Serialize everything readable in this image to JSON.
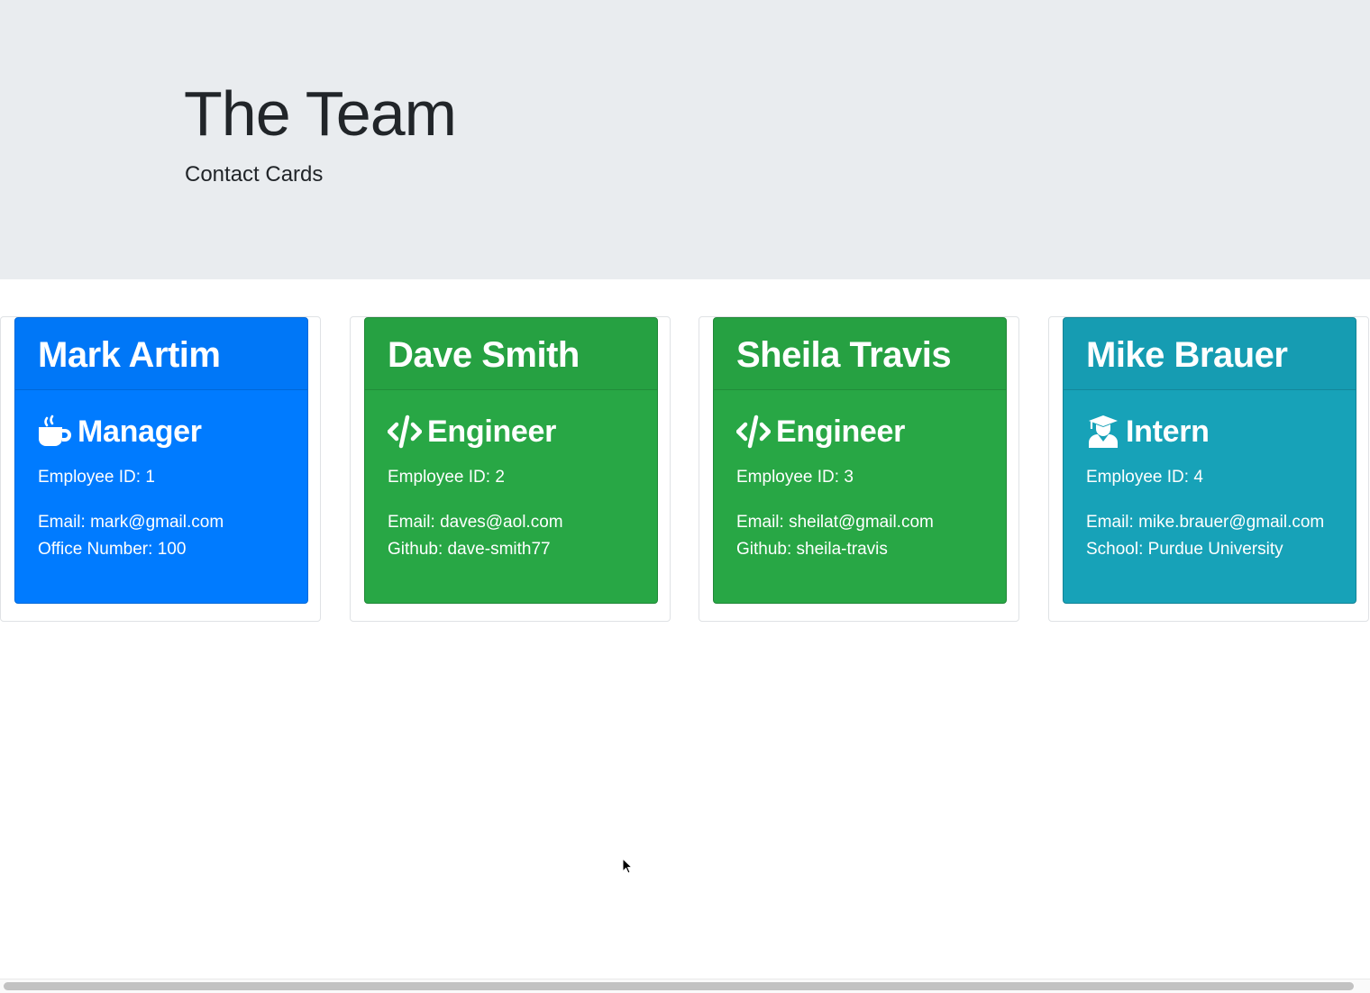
{
  "header": {
    "title": "The Team",
    "subtitle": "Contact Cards"
  },
  "cards": [
    {
      "name": "Mark Artim",
      "role": "Manager",
      "role_icon": "coffee-mug-icon",
      "color": "#007bff",
      "id_line": "Employee ID: 1",
      "email_line": "Email: mark@gmail.com",
      "extra_line": "Office Number: 100"
    },
    {
      "name": "Dave Smith",
      "role": "Engineer",
      "role_icon": "code-brackets-icon",
      "color": "#28a745",
      "id_line": "Employee ID: 2",
      "email_line": "Email: daves@aol.com",
      "extra_line": "Github: dave-smith77"
    },
    {
      "name": "Sheila Travis",
      "role": "Engineer",
      "role_icon": "code-brackets-icon",
      "color": "#28a745",
      "id_line": "Employee ID: 3",
      "email_line": "Email: sheilat@gmail.com",
      "extra_line": "Github: sheila-travis"
    },
    {
      "name": "Mike Brauer",
      "role": "Intern",
      "role_icon": "graduate-icon",
      "color": "#17a2b8",
      "id_line": "Employee ID: 4",
      "email_line": "Email: mike.brauer@gmail.com",
      "extra_line": "School: Purdue University"
    }
  ]
}
